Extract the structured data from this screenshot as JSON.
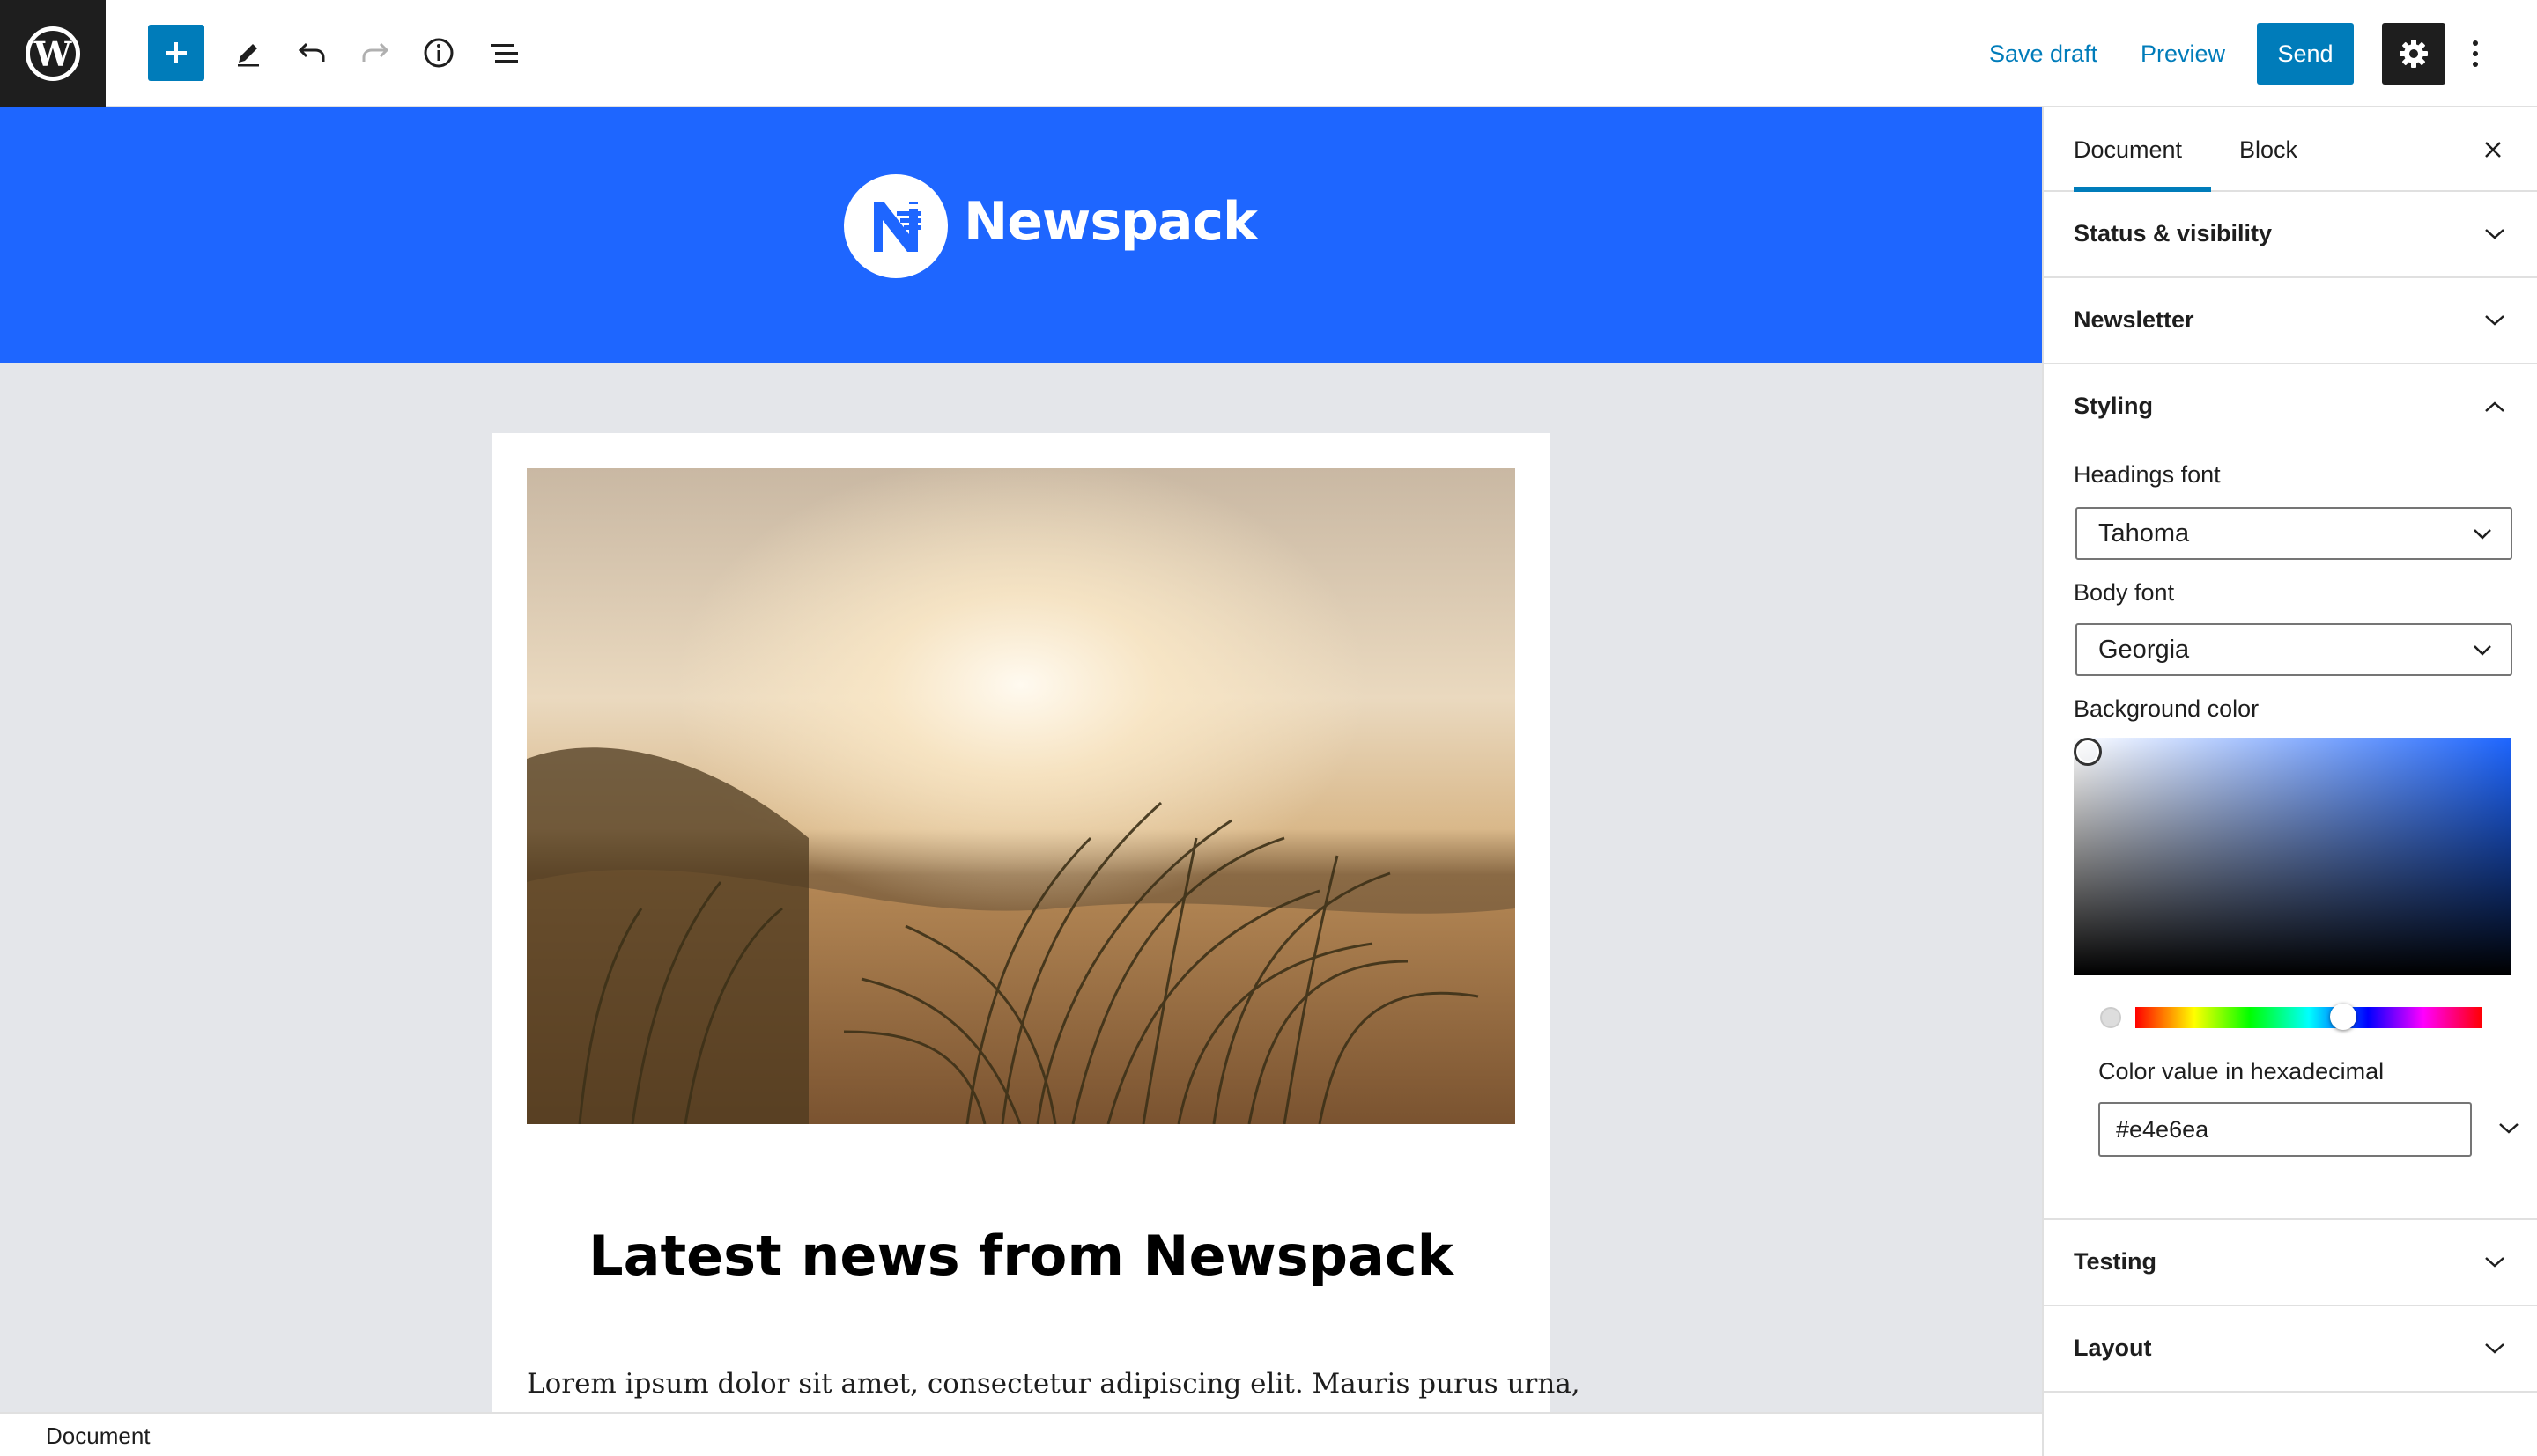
{
  "toolbar": {
    "logo_letter": "W",
    "save_draft": "Save draft",
    "preview": "Preview",
    "send": "Send"
  },
  "canvas": {
    "background_color": "#e4e6ea",
    "header_color": "#1e66ff",
    "brand_name": "Newspack",
    "headline": "Latest news from Newspack",
    "body_text": "Lorem ipsum dolor sit amet, consectetur adipiscing elit. Mauris purus urna,"
  },
  "statusbar": {
    "label": "Document"
  },
  "sidebar": {
    "tabs": [
      {
        "label": "Document",
        "active": true
      },
      {
        "label": "Block",
        "active": false
      }
    ],
    "panels": {
      "status_visibility": "Status & visibility",
      "newsletter": "Newsletter",
      "styling": "Styling",
      "testing": "Testing",
      "layout": "Layout"
    },
    "styling": {
      "headings_font_label": "Headings font",
      "headings_font_value": "Tahoma",
      "body_font_label": "Body font",
      "body_font_value": "Georgia",
      "background_color_label": "Background color",
      "hex_label": "Color value in hexadecimal",
      "hex_value": "#e4e6ea",
      "hue_fraction": 0.6
    }
  },
  "colors": {
    "accent": "#007cba",
    "dark": "#1e1e1e"
  }
}
